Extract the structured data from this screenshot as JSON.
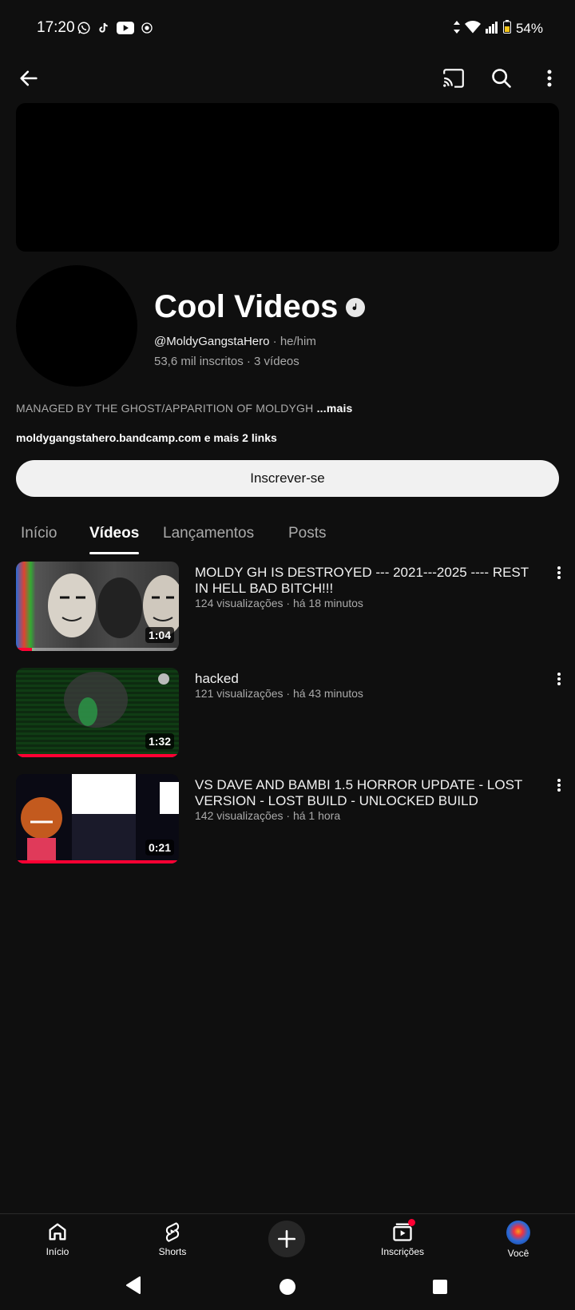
{
  "status_bar": {
    "time": "17:20",
    "battery": "54%",
    "left_icons": [
      "whatsapp-icon",
      "tiktok-icon",
      "youtube-icon",
      "record-icon"
    ],
    "right_icons": [
      "data-arrows-icon",
      "wifi-icon",
      "signal-icon",
      "battery-icon"
    ]
  },
  "top_bar": {
    "icons": [
      "back-arrow-icon",
      "cast-icon",
      "search-icon",
      "more-vert-icon"
    ]
  },
  "channel": {
    "name": "Cool Videos",
    "handle": "@MoldyGangstaHero",
    "pronouns": "he/him",
    "subscribers": "53,6 mil inscritos",
    "video_count": "3 vídeos",
    "description": "MANAGED BY THE GHOST/APPARITION OF MOLDYGH",
    "description_more": "...mais",
    "links": "moldygangstahero.bandcamp.com e mais 2 links",
    "subscribe_label": "Inscrever-se"
  },
  "tabs": [
    {
      "label": "Início",
      "active": false
    },
    {
      "label": "Vídeos",
      "active": true
    },
    {
      "label": "Lançamentos",
      "active": false
    },
    {
      "label": "Posts",
      "active": false
    }
  ],
  "videos": [
    {
      "title": "MOLDY GH IS DESTROYED --- 2021---2025 ---- REST IN HELL BAD BITCH!!!",
      "views": "124 visualizações",
      "age": "há 18 minutos",
      "duration": "1:04"
    },
    {
      "title": "hacked",
      "views": "121 visualizações",
      "age": "há 43 minutos",
      "duration": "1:32"
    },
    {
      "title": "VS DAVE AND BAMBI 1.5 HORROR UPDATE - LOST VERSION - LOST BUILD - UNLOCKED BUILD",
      "views": "142 visualizações",
      "age": "há 1 hora",
      "duration": "0:21"
    }
  ],
  "bottom_nav": [
    {
      "label": "Início",
      "icon": "home-icon"
    },
    {
      "label": "Shorts",
      "icon": "shorts-icon"
    },
    {
      "label": "",
      "icon": "create-plus-icon"
    },
    {
      "label": "Inscrições",
      "icon": "subscriptions-icon"
    },
    {
      "label": "Você",
      "icon": "you-avatar-icon"
    }
  ],
  "colors": {
    "background": "#0f0f0f",
    "accent_red": "#ff0033",
    "text_secondary": "#aaaaaa"
  }
}
